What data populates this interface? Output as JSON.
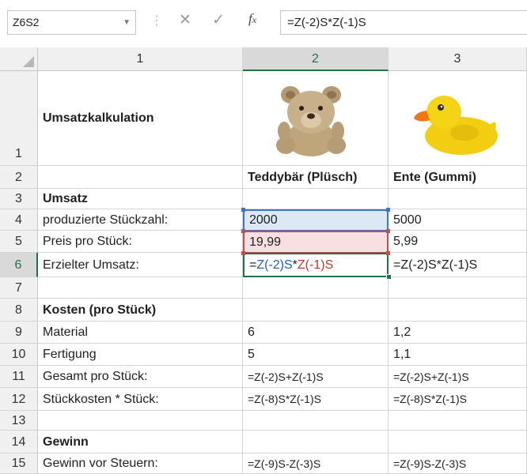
{
  "formula_bar": {
    "name_box": "Z6S2",
    "cancel_icon": "✕",
    "enter_icon": "✓",
    "fx_label": "fx",
    "formula": "=Z(-2)S*Z(-1)S"
  },
  "columns": [
    "1",
    "2",
    "3"
  ],
  "rows": [
    "1",
    "2",
    "3",
    "4",
    "5",
    "6",
    "7",
    "8",
    "9",
    "10",
    "11",
    "12",
    "13",
    "14",
    "15"
  ],
  "sheet": {
    "r1": {
      "c1": "Umsatzkalkulation"
    },
    "r2": {
      "c2": "Teddybär (Plüsch)",
      "c3": "Ente (Gummi)"
    },
    "r3": {
      "c1": "Umsatz"
    },
    "r4": {
      "c1": "produzierte Stückzahl:",
      "c2": "2000",
      "c3": "5000"
    },
    "r5": {
      "c1": "Preis pro Stück:",
      "c2": "19,99",
      "c3": "5,99"
    },
    "r6": {
      "c1": "Erzielter Umsatz:",
      "c2_part1": "=",
      "c2_part2": "Z(-2)S",
      "c2_part3": "*",
      "c2_part4": "Z(-1)S",
      "c3": "=Z(-2)S*Z(-1)S"
    },
    "r8": {
      "c1": "Kosten (pro Stück)"
    },
    "r9": {
      "c1": "Material",
      "c2": "6",
      "c3": "1,2"
    },
    "r10": {
      "c1": "Fertigung",
      "c2": "5",
      "c3": "1,1"
    },
    "r11": {
      "c1": "Gesamt pro Stück:",
      "c2": "=Z(-2)S+Z(-1)S",
      "c3": "=Z(-2)S+Z(-1)S"
    },
    "r12": {
      "c1": "Stückkosten * Stück:",
      "c2": "=Z(-8)S*Z(-1)S",
      "c3": "=Z(-8)S*Z(-1)S"
    },
    "r14": {
      "c1": "Gewinn"
    },
    "r15": {
      "c1": "Gewinn vor Steuern:",
      "c2": "=Z(-9)S-Z(-3)S",
      "c3": "=Z(-9)S-Z(-3)S"
    }
  },
  "colors": {
    "selection_green": "#217346",
    "ref_blue": "#4472c4",
    "ref_red": "#c0504d"
  }
}
